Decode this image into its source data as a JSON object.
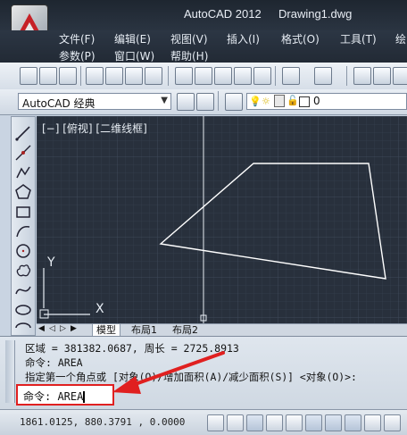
{
  "title": {
    "app": "AutoCAD 2012",
    "document": "Drawing1.dwg"
  },
  "menus": {
    "row1": [
      "文件(F)",
      "编辑(E)",
      "视图(V)",
      "插入(I)",
      "格式(O)",
      "工具(T)",
      "绘"
    ],
    "row2": [
      "参数(P)",
      "窗口(W)",
      "帮助(H)"
    ]
  },
  "workspace": {
    "selected": "AutoCAD 经典"
  },
  "layer": {
    "value": "0"
  },
  "viewport": {
    "label": "[−] [俯视] [二维线框]"
  },
  "tabs": [
    "模型",
    "布局1",
    "布局2"
  ],
  "command_history": [
    "区域 = 381382.0687, 周长 = 2725.8913",
    "命令: AREA",
    "指定第一个角点或 [对象(O)/增加面积(A)/减少面积(S)] <对象(O)>:"
  ],
  "command_input": {
    "value": "命令: AREA"
  },
  "status": {
    "coordinates": "1861.0125, 880.3791 , 0.0000"
  },
  "ucs": {
    "y_label": "Y",
    "x_label": "X"
  },
  "colors": {
    "canvas": "#28303c",
    "highlight": "#e02020",
    "polygon": "#ffffff"
  }
}
